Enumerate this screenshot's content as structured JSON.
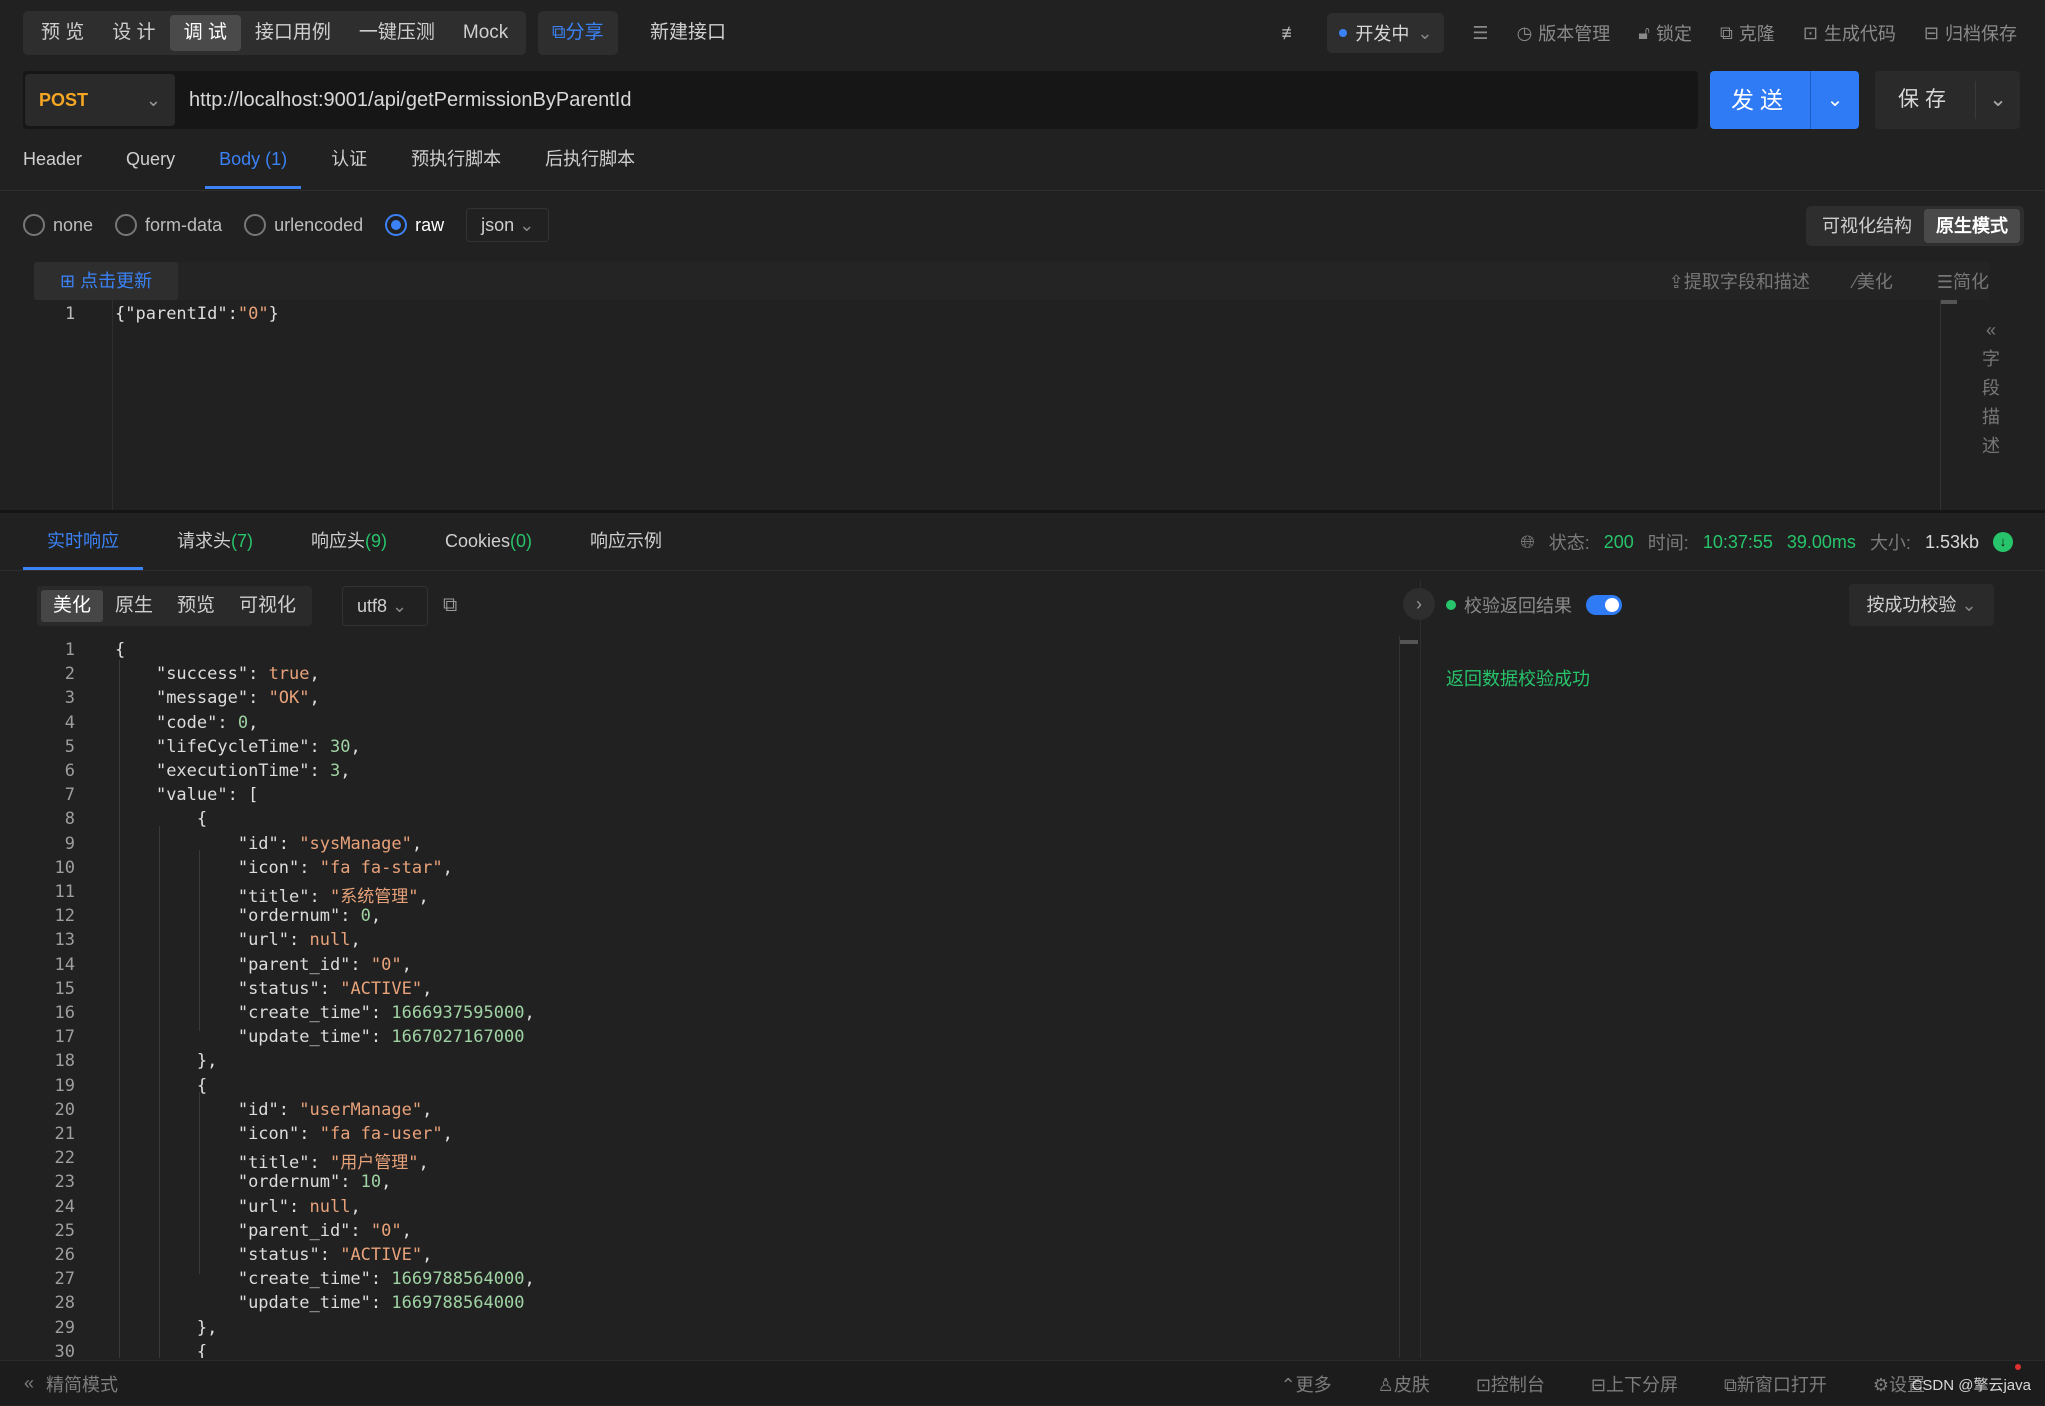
{
  "top_tabs": [
    "预 览",
    "设 计",
    "调 试",
    "接口用例",
    "一键压测",
    "Mock"
  ],
  "top_tab_active": 2,
  "share_label": "分享",
  "new_api_label": "新建接口",
  "env_label": "开发中",
  "top_tools": {
    "version": "版本管理",
    "lock": "锁定",
    "clone": "克隆",
    "gencode": "生成代码",
    "archive": "归档保存"
  },
  "method": "POST",
  "url": "http://localhost:9001/api/getPermissionByParentId",
  "send_label": "发送",
  "save_label": "保存",
  "request_tabs": [
    "Header",
    "Query",
    "Body (1)",
    "认证",
    "预执行脚本",
    "后执行脚本"
  ],
  "request_tab_active": 2,
  "body_types": [
    "none",
    "form-data",
    "urlencoded",
    "raw"
  ],
  "body_type_selected": "raw",
  "body_format": "json",
  "view_modes": [
    "可视化结构",
    "原生模式"
  ],
  "view_mode_active": "原生模式",
  "update_label": "点击更新",
  "editor_tools": {
    "extract": "提取字段和描述",
    "beautify": "美化",
    "simplify": "简化"
  },
  "request_body": {
    "line": "1",
    "key": "\"parentId\"",
    "value": "\"0\""
  },
  "field_desc_label": [
    "字",
    "段",
    "描",
    "述"
  ],
  "response_tabs": [
    {
      "label": "实时响应",
      "count": ""
    },
    {
      "label": "请求头",
      "count": "(7)"
    },
    {
      "label": "响应头",
      "count": "(9)"
    },
    {
      "label": "Cookies",
      "count": "(0)"
    },
    {
      "label": "响应示例",
      "count": ""
    }
  ],
  "status": {
    "label_status": "状态:",
    "code": "200",
    "label_time": "时间:",
    "time": "10:37:55",
    "duration": "39.00ms",
    "label_size": "大小:",
    "size": "1.53kb"
  },
  "response_view_tabs": [
    "美化",
    "原生",
    "预览",
    "可视化"
  ],
  "response_view_active": "美化",
  "encoding": "utf8",
  "validate_label": "校验返回结果",
  "validate_mode": "按成功校验",
  "validate_result": "返回数据校验成功",
  "response_lines": [
    "{",
    "    \"success\": true,",
    "    \"message\": \"OK\",",
    "    \"code\": 0,",
    "    \"lifeCycleTime\": 30,",
    "    \"executionTime\": 3,",
    "    \"value\": [",
    "        {",
    "            \"id\": \"sysManage\",",
    "            \"icon\": \"fa fa-star\",",
    "            \"title\": \"系统管理\",",
    "            \"ordernum\": 0,",
    "            \"url\": null,",
    "            \"parent_id\": \"0\",",
    "            \"status\": \"ACTIVE\",",
    "            \"create_time\": 1666937595000,",
    "            \"update_time\": 1667027167000",
    "        },",
    "        {",
    "            \"id\": \"userManage\",",
    "            \"icon\": \"fa fa-user\",",
    "            \"title\": \"用户管理\",",
    "            \"ordernum\": 10,",
    "            \"url\": null,",
    "            \"parent_id\": \"0\",",
    "            \"status\": \"ACTIVE\",",
    "            \"create_time\": 1669788564000,",
    "            \"update_time\": 1669788564000",
    "        },",
    "        {"
  ],
  "footer_left": "精简模式",
  "footer_right": [
    "更多",
    "皮肤",
    "控制台",
    "上下分屏",
    "新窗口打开",
    "设置"
  ],
  "watermark": "CSDN @擎云java",
  "colors": {
    "accent": "#2f7bf5",
    "success": "#27c46b",
    "method": "#f5a623",
    "bg": "#212121"
  }
}
